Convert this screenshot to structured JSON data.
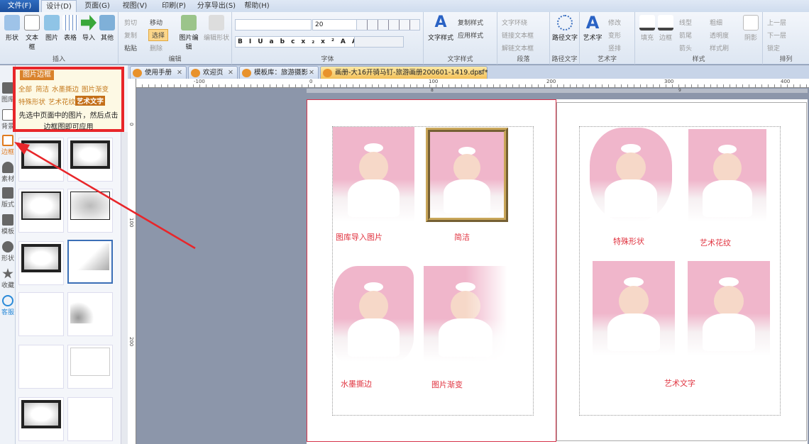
{
  "menu": {
    "tabs": [
      "文件(F)",
      "设计(D)",
      "页面(G)",
      "视图(V)",
      "印刷(P)",
      "分享导出(S)",
      "帮助(H)"
    ],
    "active": "设计(D)"
  },
  "ribbon": {
    "insert": {
      "label": "插入",
      "buttons": [
        "形状",
        "文本框",
        "图片",
        "表格",
        "导入",
        "其他"
      ]
    },
    "edit": {
      "label": "编辑",
      "cut": "剪切",
      "copy": "复制",
      "paste": "粘贴",
      "move": "移动",
      "select": "选择",
      "delete": "删除",
      "image_edit": "图片编辑",
      "edit_shape": "编辑形状"
    },
    "font": {
      "label": "字体",
      "font_name": "",
      "font_size": "20",
      "buttons": [
        "B",
        "I",
        "U",
        "abc",
        "x₂",
        "x²",
        "A",
        "A"
      ]
    },
    "text_style": {
      "label": "文字样式",
      "big": "文字样式",
      "copy_style": "复制样式",
      "apply_style": "应用样式"
    },
    "paragraph": {
      "label": "段落",
      "wrap": "文字环绕",
      "link": "链接文本框",
      "unlink": "解链文本框"
    },
    "path_text": {
      "label": "路径文字",
      "big": "路径文字"
    },
    "art_text": {
      "label": "艺术字",
      "big": "艺术字",
      "modify": "修改",
      "transform": "变形",
      "vertical": "竖排"
    },
    "style": {
      "label": "样式",
      "fill": "填充",
      "border": "边框",
      "line_type": "线型",
      "line_end": "箭尾",
      "arrow": "箭头",
      "thickness": "粗细",
      "opacity": "透明度",
      "painter": "样式刷",
      "shadow": "阴影"
    },
    "arrange": {
      "label": "排列",
      "up": "上一层",
      "down": "下一层",
      "lock": "锁定"
    }
  },
  "leftbar": {
    "items": [
      "图库",
      "背景",
      "边框",
      "素材",
      "版式",
      "模板",
      "形状",
      "收藏",
      "客服"
    ],
    "active": "边框"
  },
  "popup": {
    "title": "图片边框",
    "categories": [
      "全部",
      "简洁",
      "水墨撕边",
      "图片渐变",
      "特殊形状",
      "艺术花纹",
      "艺术文字"
    ],
    "active": "艺术文字",
    "hint_line1": "先选中页面中的图片，然后点击",
    "hint_line2": "边框图即可应用"
  },
  "doc_tabs": [
    {
      "label": "使用手册"
    },
    {
      "label": "欢迎页"
    },
    {
      "label": "模板库：旅游摄影"
    },
    {
      "label": "画册-大16开骑马钉-旅游画册200601-1419.dpsf*",
      "active": true
    }
  ],
  "ruler": {
    "h_ticks": [
      "-100",
      "0",
      "100",
      "200",
      "300",
      "400"
    ],
    "v_ticks": [
      "0",
      "100",
      "200"
    ],
    "page_left": "8",
    "page_right": "9"
  },
  "captions": {
    "p1": "图库导入图片",
    "p2": "简洁",
    "p3": "水墨撕边",
    "p4": "图片渐变",
    "p5": "特殊形状",
    "p6": "艺术花纹",
    "p7": "艺术文字"
  },
  "colors": {
    "accent_red": "#e8262a",
    "tab_orange": "#f3c058",
    "ribbon_bg": "#dde6f2"
  }
}
